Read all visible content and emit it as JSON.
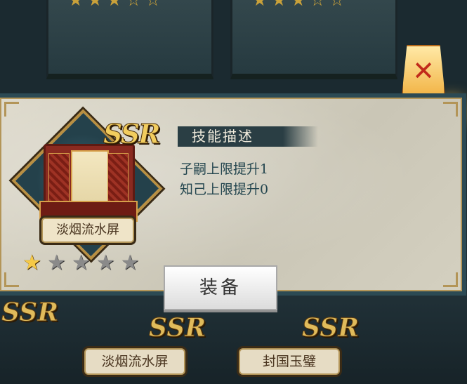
{
  "modal": {
    "item_name": "淡烟流水屏",
    "rarity": "SSR",
    "stars_filled": 1,
    "stars_total": 5,
    "description_header": "技能描述",
    "description_lines": [
      "子嗣上限提升1",
      "知己上限提升0"
    ],
    "equip_button_label": "装备",
    "close_icon": "close-x-lantern"
  },
  "background": {
    "cards": [
      {
        "rarity": "SSR",
        "name": "淡烟流水屏"
      },
      {
        "rarity": "SSR",
        "name": "封国玉璧"
      }
    ],
    "left_ssr": "SSR"
  },
  "colors": {
    "ssr_gold": "#f2cd5e",
    "panel_bg": "#d6d2c3",
    "panel_border": "#2c4a54",
    "header_bg": "#2a3e44",
    "desc_text": "#24464f",
    "star_on": "#f5c947",
    "star_off": "#8a8a8a"
  }
}
